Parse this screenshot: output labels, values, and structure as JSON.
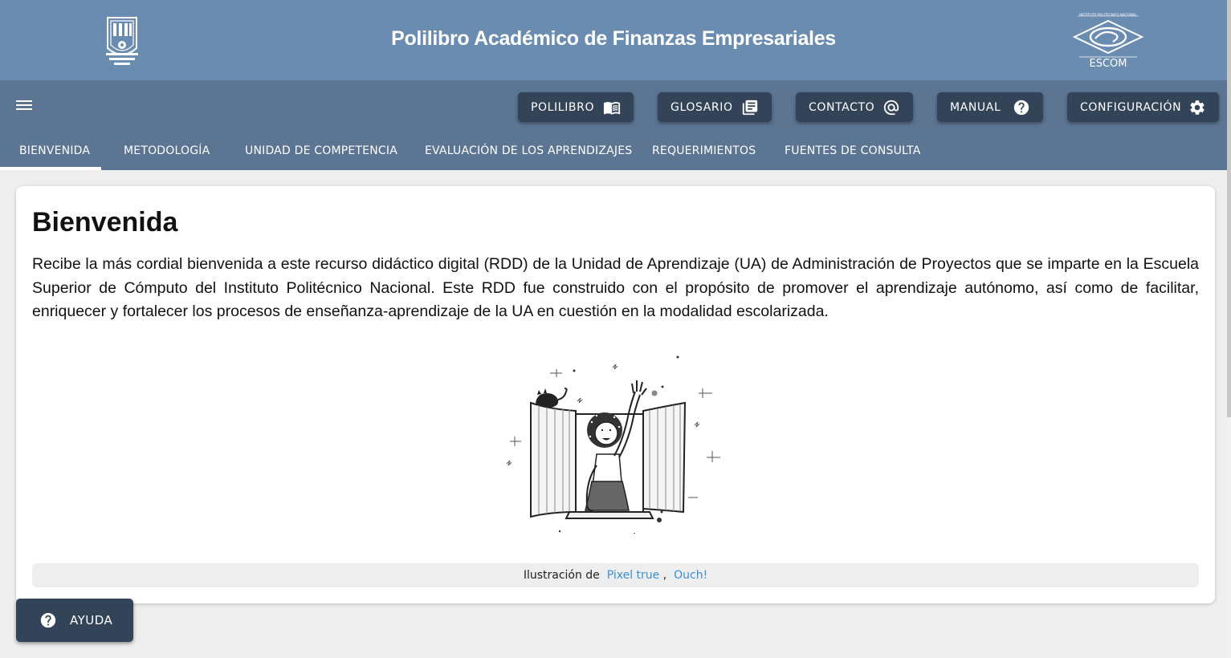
{
  "header": {
    "title": "Polilibro Académico de Finanzas Empresariales",
    "left_logo": "ipn-logo",
    "right_logo": "escom-logo",
    "right_logo_text": "ESCOM",
    "right_logo_small_text": "INSTITUTO POLITÉCNICO NACIONAL",
    "bg_color": "#6b8cb1"
  },
  "toolbar": {
    "menu_icon": "hamburger-menu-icon",
    "buttons": [
      {
        "label": "POLILIBRO",
        "icon": "open-book-icon"
      },
      {
        "label": "GLOSARIO",
        "icon": "library-books-icon"
      },
      {
        "label": "CONTACTO",
        "icon": "at-sign-icon"
      },
      {
        "label": "MANUAL",
        "icon": "help-circle-icon"
      },
      {
        "label": "CONFIGURACIÓN",
        "icon": "gear-icon"
      }
    ],
    "bg_color": "#5b7593",
    "button_color": "#334459"
  },
  "tabs": [
    {
      "label": "BIENVENIDA",
      "active": true
    },
    {
      "label": "METODOLOGÍA",
      "active": false
    },
    {
      "label": "UNIDAD DE COMPETENCIA",
      "active": false
    },
    {
      "label": "EVALUACIÓN DE LOS APRENDIZAJES",
      "active": false
    },
    {
      "label": "REQUERIMIENTOS",
      "active": false
    },
    {
      "label": "FUENTES DE CONSULTA",
      "active": false
    }
  ],
  "main": {
    "title": "Bienvenida",
    "paragraph": "Recibe la más cordial bienvenida a este recurso didáctico digital (RDD) de la Unidad de Aprendizaje (UA) de Administración de Proyectos que se imparte en la Escuela Superior de Cómputo del Instituto Politécnico Nacional. Este RDD fue construido con el propósito de promover el aprendizaje autónomo, así como de facilitar, enriquecer y fortalecer los procesos de enseñanza-aprendizaje de la UA en cuestión en la modalidad escolarizada.",
    "illustration": "woman-waving-at-window-illustration",
    "credit": {
      "prefix": "Ilustración de",
      "link1": "Pixel true",
      "separator": ",",
      "link2": "Ouch!"
    }
  },
  "help": {
    "label": "AYUDA",
    "icon": "help-circle-icon"
  },
  "colors": {
    "link": "#3a8fd6",
    "page_bg": "#eeeeee"
  }
}
